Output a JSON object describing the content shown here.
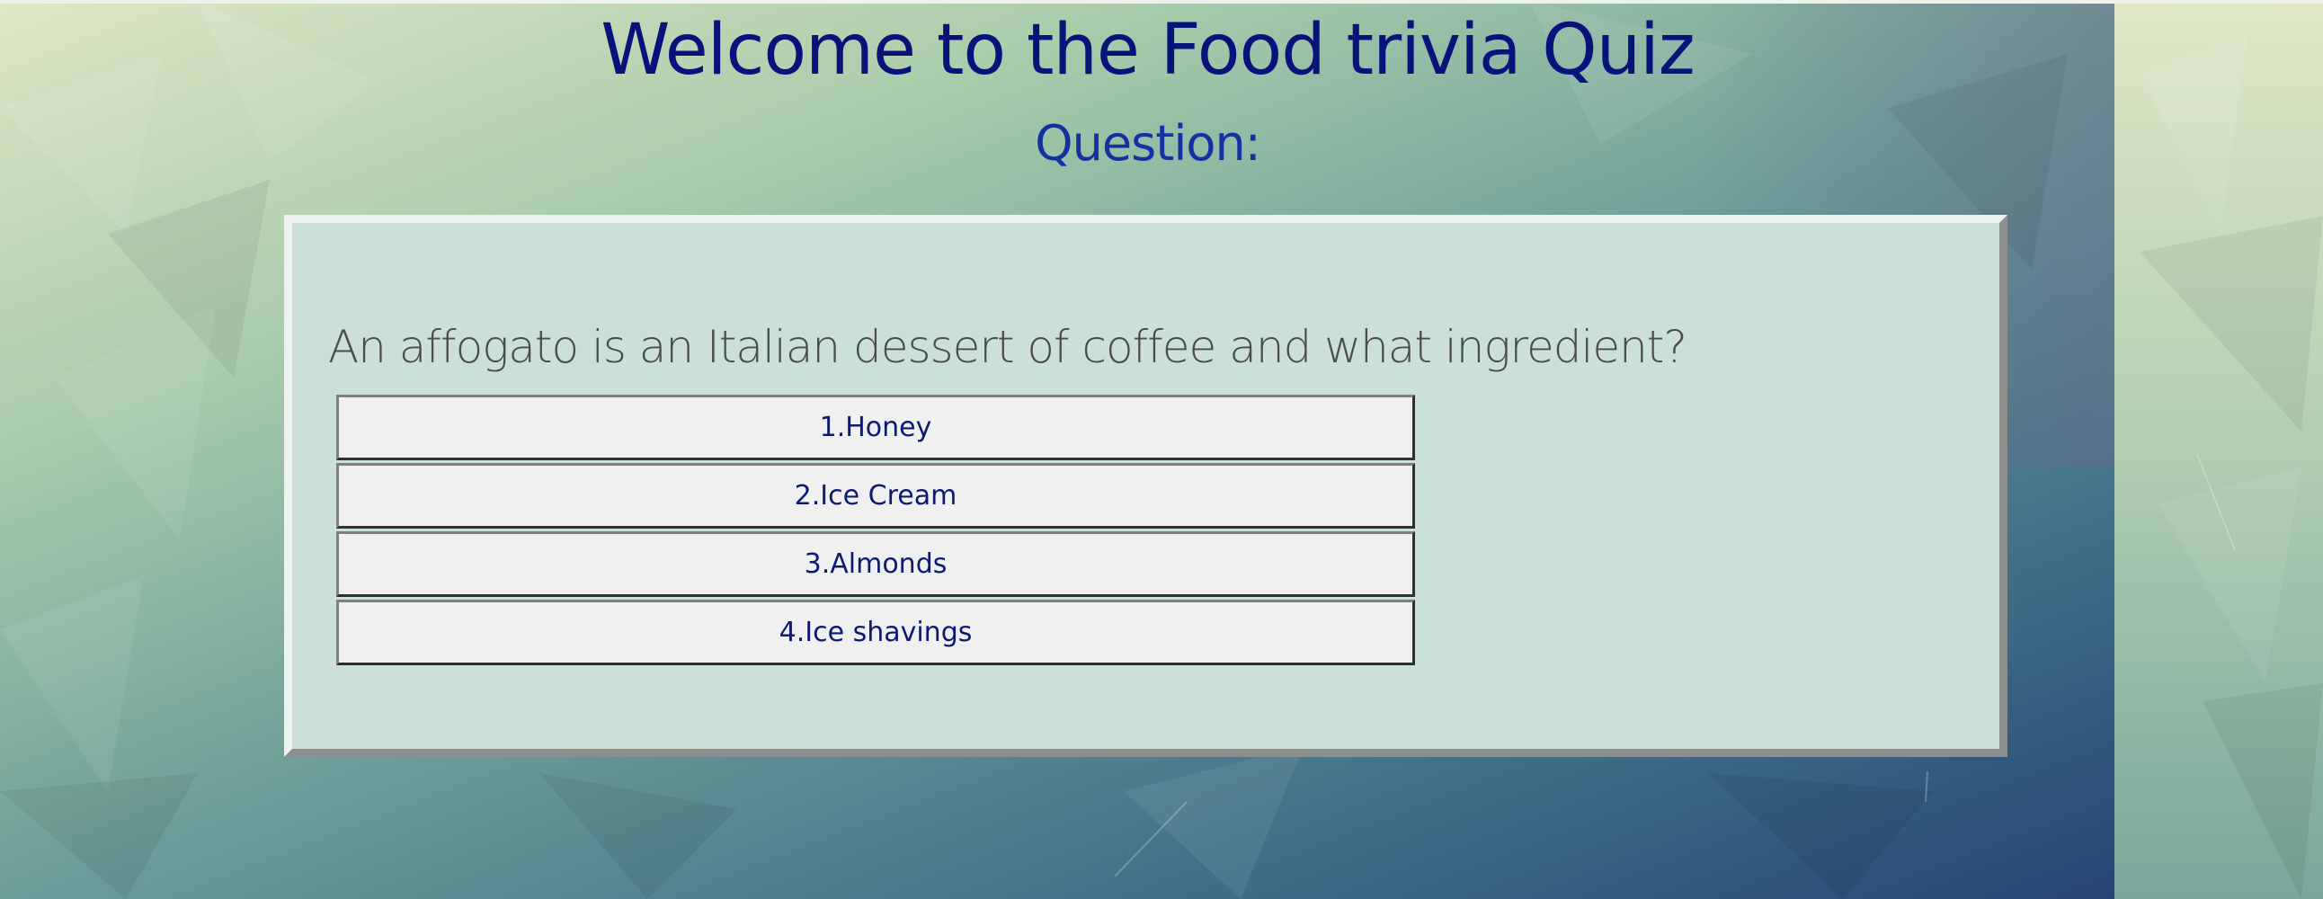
{
  "page": {
    "title": "Welcome to the Food trivia Quiz",
    "subtitle": "Question:"
  },
  "quiz": {
    "question": "An affogato is an Italian dessert of coffee and what ingredient?",
    "answers": [
      "1.Honey",
      "2.Ice Cream",
      "3.Almonds",
      "4.Ice shavings"
    ]
  },
  "colors": {
    "title": "#07137a",
    "subtitle": "#1530a0",
    "card_background": "#cbe0d7",
    "button_background": "#f0f0f0",
    "button_text": "#0d1a72"
  },
  "icons": {
    "background": "low-poly-gradient-background"
  }
}
